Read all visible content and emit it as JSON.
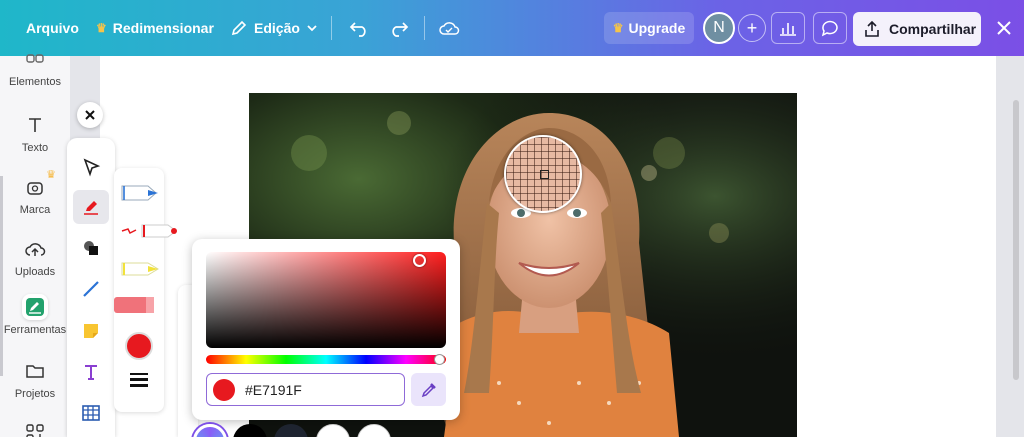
{
  "topbar": {
    "file_label": "Arquivo",
    "resize_label": "Redimensionar",
    "edit_label": "Edição",
    "upgrade_label": "Upgrade",
    "avatar_initial": "N",
    "share_label": "Compartilhar"
  },
  "sidebar": {
    "items": [
      {
        "label": "Elementos"
      },
      {
        "label": "Texto"
      },
      {
        "label": "Marca"
      },
      {
        "label": "Uploads"
      },
      {
        "label": "Ferramentas"
      },
      {
        "label": "Projetos"
      }
    ]
  },
  "color_picker": {
    "hex_value": "#E7191F",
    "selected_color": "#E7191F"
  },
  "colors": {
    "accent": "#7d4fe6",
    "brand_teal": "#1fb7c9",
    "pen_blue": "#2a73d6",
    "pen_red": "#E7191F",
    "pen_yellow": "#f2e23a",
    "pen_pink": "#f0727a",
    "shirt_orange": "#e0823f"
  },
  "bottom_swatches": [
    "#8a5cf6",
    "#000000",
    "#1e2430",
    "#ffffff",
    "#ffffff"
  ]
}
